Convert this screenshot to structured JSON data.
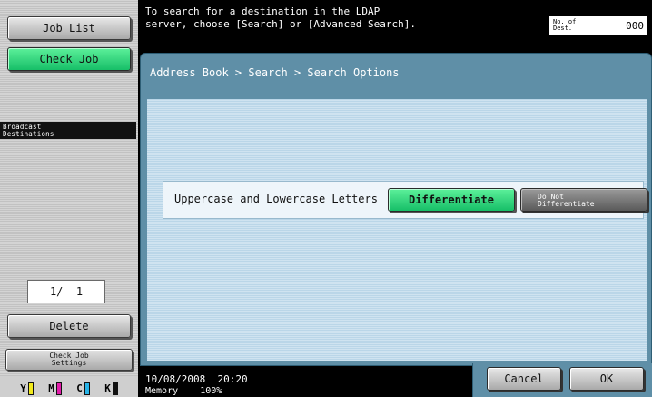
{
  "sidebar": {
    "job_list": "Job List",
    "check_job": "Check Job",
    "broadcast_destinations": "Broadcast\nDestinations",
    "page_counter": "1/  1",
    "delete": "Delete",
    "check_job_settings": "Check Job\nSettings",
    "toner": [
      {
        "label": "Y",
        "color": "#f2ea1c"
      },
      {
        "label": "M",
        "color": "#e21caa"
      },
      {
        "label": "C",
        "color": "#28b4e8"
      },
      {
        "label": "K",
        "color": "#111111"
      }
    ]
  },
  "header": {
    "message": "To search for a destination in the LDAP\nserver, choose [Search] or [Advanced Search].",
    "dest_label": "No. of\nDest.",
    "dest_value": "000"
  },
  "main": {
    "breadcrumb": "Address Book > Search > Search Options",
    "option": {
      "label": "Uppercase and Lowercase Letters",
      "differentiate": "Differentiate",
      "not_differentiate": "Do Not\nDifferentiate",
      "selected": "Differentiate"
    }
  },
  "footer": {
    "date": "10/08/2008",
    "time": "20:20",
    "memory_label": "Memory",
    "memory_value": "100%",
    "cancel": "Cancel",
    "ok": "OK"
  },
  "colors": {
    "accent_green": "#17bf68",
    "panel_blue": "#5f8fa7"
  }
}
